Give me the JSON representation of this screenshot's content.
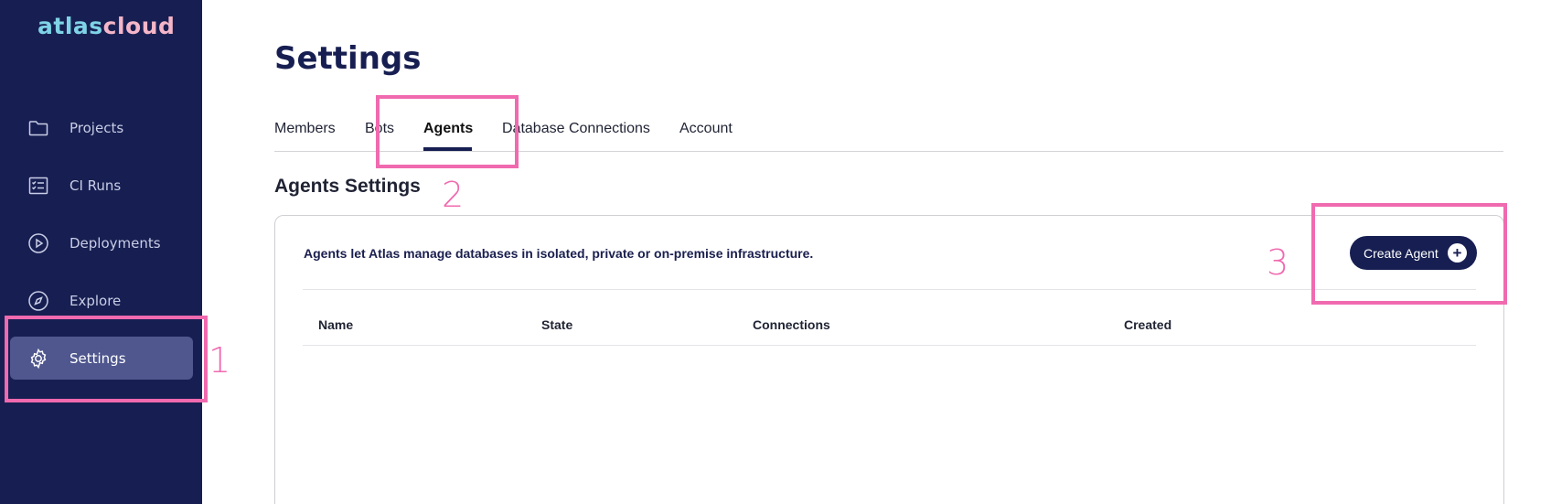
{
  "logo": {
    "part1": "atlas",
    "part2": "cloud"
  },
  "sidebar": {
    "items": [
      {
        "label": "Projects",
        "icon": "folder-icon"
      },
      {
        "label": "CI Runs",
        "icon": "checklist-icon"
      },
      {
        "label": "Deployments",
        "icon": "play-circle-icon"
      },
      {
        "label": "Explore",
        "icon": "compass-icon"
      },
      {
        "label": "Settings",
        "icon": "gear-icon",
        "active": true
      }
    ]
  },
  "page": {
    "title": "Settings"
  },
  "tabs": [
    {
      "label": "Members"
    },
    {
      "label": "Bots"
    },
    {
      "label": "Agents",
      "active": true
    },
    {
      "label": "Database Connections"
    },
    {
      "label": "Account"
    }
  ],
  "section": {
    "title": "Agents Settings"
  },
  "card": {
    "description": "Agents let Atlas manage databases in isolated, private or on-premise infrastructure.",
    "create_button": "Create Agent"
  },
  "table": {
    "columns": [
      "Name",
      "State",
      "Connections",
      "Created"
    ]
  },
  "annotations": [
    "1",
    "2",
    "3"
  ],
  "colors": {
    "sidebar_bg": "#171f52",
    "active_item": "#4f578e",
    "annotation": "#f06aaf"
  }
}
